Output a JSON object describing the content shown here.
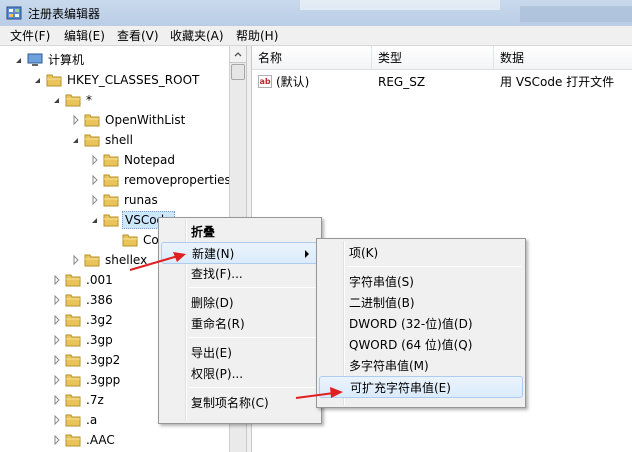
{
  "window": {
    "title": "注册表编辑器"
  },
  "menu": [
    "文件(F)",
    "编辑(E)",
    "查看(V)",
    "收藏夹(A)",
    "帮助(H)"
  ],
  "tree": [
    {
      "label": "计算机",
      "depth": 0,
      "expander": "expanded",
      "icon": "computer-icon"
    },
    {
      "label": "HKEY_CLASSES_ROOT",
      "depth": 1,
      "expander": "expanded",
      "icon": "folder-icon"
    },
    {
      "label": "*",
      "depth": 2,
      "expander": "expanded",
      "icon": "folder-icon"
    },
    {
      "label": "OpenWithList",
      "depth": 3,
      "expander": "collapsed",
      "icon": "folder-icon"
    },
    {
      "label": "shell",
      "depth": 3,
      "expander": "expanded",
      "icon": "folder-icon"
    },
    {
      "label": "Notepad",
      "depth": 4,
      "expander": "collapsed",
      "icon": "folder-icon"
    },
    {
      "label": "removeproperties",
      "depth": 4,
      "expander": "collapsed",
      "icon": "folder-icon"
    },
    {
      "label": "runas",
      "depth": 4,
      "expander": "collapsed",
      "icon": "folder-icon"
    },
    {
      "label": "VSCode",
      "depth": 4,
      "expander": "expanded",
      "icon": "folder-icon",
      "selected": true
    },
    {
      "label": "Co",
      "depth": 5,
      "expander": "none",
      "icon": "folder-icon"
    },
    {
      "label": "shellex",
      "depth": 3,
      "expander": "collapsed",
      "icon": "folder-icon"
    },
    {
      "label": ".001",
      "depth": 2,
      "expander": "collapsed",
      "icon": "folder-icon"
    },
    {
      "label": ".386",
      "depth": 2,
      "expander": "collapsed",
      "icon": "folder-icon"
    },
    {
      "label": ".3g2",
      "depth": 2,
      "expander": "collapsed",
      "icon": "folder-icon"
    },
    {
      "label": ".3gp",
      "depth": 2,
      "expander": "collapsed",
      "icon": "folder-icon"
    },
    {
      "label": ".3gp2",
      "depth": 2,
      "expander": "collapsed",
      "icon": "folder-icon"
    },
    {
      "label": ".3gpp",
      "depth": 2,
      "expander": "collapsed",
      "icon": "folder-icon"
    },
    {
      "label": ".7z",
      "depth": 2,
      "expander": "collapsed",
      "icon": "folder-icon"
    },
    {
      "label": ".a",
      "depth": 2,
      "expander": "collapsed",
      "icon": "folder-icon"
    },
    {
      "label": ".AAC",
      "depth": 2,
      "expander": "collapsed",
      "icon": "folder-icon"
    }
  ],
  "list": {
    "columns": [
      "名称",
      "类型",
      "数据"
    ],
    "rows": [
      {
        "name": "(默认)",
        "type": "REG_SZ",
        "data": "用 VSCode 打开文件"
      }
    ]
  },
  "context_menu": [
    {
      "label": "折叠",
      "bold": true
    },
    {
      "label": "新建(N)",
      "submenu": true,
      "highlighted": true
    },
    {
      "label": "查找(F)..."
    },
    {
      "separator": true
    },
    {
      "label": "删除(D)"
    },
    {
      "label": "重命名(R)"
    },
    {
      "separator": true
    },
    {
      "label": "导出(E)"
    },
    {
      "label": "权限(P)..."
    },
    {
      "separator": true
    },
    {
      "label": "复制项名称(C)"
    }
  ],
  "submenu": [
    {
      "label": "项(K)"
    },
    {
      "separator": true
    },
    {
      "label": "字符串值(S)"
    },
    {
      "label": "二进制值(B)"
    },
    {
      "label": "DWORD (32-位)值(D)"
    },
    {
      "label": "QWORD (64 位)值(Q)"
    },
    {
      "label": "多字符串值(M)"
    },
    {
      "label": "可扩充字符串值(E)",
      "highlighted": true
    }
  ],
  "colors": {
    "folder": "#e8c45a",
    "selection": "#cce8ff",
    "annotation_arrow": "#e02020"
  }
}
